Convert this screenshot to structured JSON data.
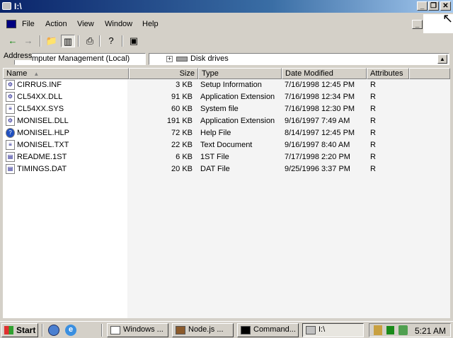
{
  "window": {
    "title": "I:\\",
    "buttons": {
      "minimize": "_",
      "restore": "❐",
      "close": "✕"
    }
  },
  "menu": [
    "File",
    "Action",
    "View",
    "Window",
    "Help"
  ],
  "address": {
    "label": "Address",
    "computer_text": "mputer Management (Local)",
    "tree_text": "Disk drives"
  },
  "columns": {
    "name": "Name",
    "size": "Size",
    "type": "Type",
    "date": "Date Modified",
    "attributes": "Attributes"
  },
  "files": [
    {
      "name": "CIRRUS.INF",
      "size": "3 KB",
      "type": "Setup Information",
      "date": "7/16/1998 12:45 PM",
      "attr": "R",
      "icon": "setup-file-icon"
    },
    {
      "name": "CL54XX.DLL",
      "size": "91 KB",
      "type": "Application Extension",
      "date": "7/16/1998 12:34 PM",
      "attr": "R",
      "icon": "dll-file-icon"
    },
    {
      "name": "CL54XX.SYS",
      "size": "60 KB",
      "type": "System file",
      "date": "7/16/1998 12:30 PM",
      "attr": "R",
      "icon": "system-file-icon"
    },
    {
      "name": "MONISEL.DLL",
      "size": "191 KB",
      "type": "Application Extension",
      "date": "9/16/1997 7:49 AM",
      "attr": "R",
      "icon": "dll-file-icon"
    },
    {
      "name": "MONISEL.HLP",
      "size": "72 KB",
      "type": "Help File",
      "date": "8/14/1997 12:45 PM",
      "attr": "R",
      "icon": "help-file-icon"
    },
    {
      "name": "MONISEL.TXT",
      "size": "22 KB",
      "type": "Text Document",
      "date": "9/16/1997 8:40 AM",
      "attr": "R",
      "icon": "text-file-icon"
    },
    {
      "name": "README.1ST",
      "size": "6 KB",
      "type": "1ST File",
      "date": "7/17/1998 2:20 PM",
      "attr": "R",
      "icon": "generic-file-icon"
    },
    {
      "name": "TIMINGS.DAT",
      "size": "20 KB",
      "type": "DAT File",
      "date": "9/25/1996 3:37 PM",
      "attr": "R",
      "icon": "generic-file-icon"
    }
  ],
  "taskbar": {
    "start": "Start",
    "tasks": [
      "Windows ...",
      "Node.js ...",
      "Command...",
      "I:\\"
    ],
    "clock": "5:21 AM"
  },
  "colors": {
    "titlebar_start": "#0a246a",
    "titlebar_end": "#a6caf0",
    "face": "#d4d0c8"
  }
}
